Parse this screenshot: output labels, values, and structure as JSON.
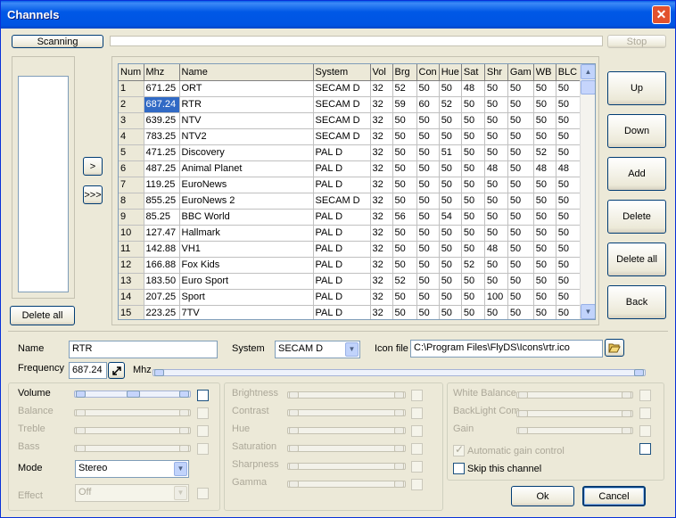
{
  "window": {
    "title": "Channels",
    "close_glyph": "✕"
  },
  "top": {
    "scanning_label": "Scanning",
    "stop_label": "Stop"
  },
  "left": {
    "add_one_label": ">",
    "add_all_label": ">>>",
    "delete_all_label": "Delete all"
  },
  "grid": {
    "columns": [
      "Num",
      "Mhz",
      "Name",
      "System",
      "Vol",
      "Brg",
      "Con",
      "Hue",
      "Sat",
      "Shr",
      "Gam",
      "WB",
      "BLC"
    ],
    "rows": [
      [
        "1",
        "671.25",
        "ORT",
        "SECAM D",
        "32",
        "52",
        "50",
        "50",
        "48",
        "50",
        "50",
        "50",
        "50"
      ],
      [
        "2",
        "687.24",
        "RTR",
        "SECAM D",
        "32",
        "59",
        "60",
        "52",
        "50",
        "50",
        "50",
        "50",
        "50"
      ],
      [
        "3",
        "639.25",
        "NTV",
        "SECAM D",
        "32",
        "50",
        "50",
        "50",
        "50",
        "50",
        "50",
        "50",
        "50"
      ],
      [
        "4",
        "783.25",
        "NTV2",
        "SECAM D",
        "32",
        "50",
        "50",
        "50",
        "50",
        "50",
        "50",
        "50",
        "50"
      ],
      [
        "5",
        "471.25",
        "Discovery",
        "PAL D",
        "32",
        "50",
        "50",
        "51",
        "50",
        "50",
        "50",
        "52",
        "50"
      ],
      [
        "6",
        "487.25",
        "Animal Planet",
        "PAL D",
        "32",
        "50",
        "50",
        "50",
        "50",
        "48",
        "50",
        "48",
        "48"
      ],
      [
        "7",
        "119.25",
        "EuroNews",
        "PAL D",
        "32",
        "50",
        "50",
        "50",
        "50",
        "50",
        "50",
        "50",
        "50"
      ],
      [
        "8",
        "855.25",
        "EuroNews 2",
        "SECAM D",
        "32",
        "50",
        "50",
        "50",
        "50",
        "50",
        "50",
        "50",
        "50"
      ],
      [
        "9",
        "85.25",
        "BBC World",
        "PAL D",
        "32",
        "56",
        "50",
        "54",
        "50",
        "50",
        "50",
        "50",
        "50"
      ],
      [
        "10",
        "127.47",
        "Hallmark",
        "PAL D",
        "32",
        "50",
        "50",
        "50",
        "50",
        "50",
        "50",
        "50",
        "50"
      ],
      [
        "11",
        "142.88",
        "VH1",
        "PAL D",
        "32",
        "50",
        "50",
        "50",
        "50",
        "48",
        "50",
        "50",
        "50"
      ],
      [
        "12",
        "166.88",
        "Fox Kids",
        "PAL D",
        "32",
        "50",
        "50",
        "50",
        "52",
        "50",
        "50",
        "50",
        "50"
      ],
      [
        "13",
        "183.50",
        "Euro Sport",
        "PAL D",
        "32",
        "52",
        "50",
        "50",
        "50",
        "50",
        "50",
        "50",
        "50"
      ],
      [
        "14",
        "207.25",
        "Sport",
        "PAL D",
        "32",
        "50",
        "50",
        "50",
        "50",
        "100",
        "50",
        "50",
        "50"
      ],
      [
        "15",
        "223.25",
        "7TV",
        "PAL D",
        "32",
        "50",
        "50",
        "50",
        "50",
        "50",
        "50",
        "50",
        "50"
      ]
    ]
  },
  "right_buttons": {
    "up": "Up",
    "down": "Down",
    "add": "Add",
    "delete": "Delete",
    "delete_all": "Delete all",
    "back": "Back"
  },
  "details": {
    "name_label": "Name",
    "name_value": "RTR",
    "system_label": "System",
    "system_value": "SECAM D",
    "icon_label": "Icon file",
    "icon_value": "C:\\Program Files\\FlyDS\\Icons\\rtr.ico",
    "frequency_label": "Frequency",
    "frequency_value": "687.24",
    "mhz_label": "Mhz"
  },
  "audio": {
    "volume": "Volume",
    "balance": "Balance",
    "treble": "Treble",
    "bass": "Bass",
    "mode_label": "Mode",
    "mode_value": "Stereo",
    "effect_label": "Effect",
    "effect_value": "Off"
  },
  "video": {
    "brightness": "Brightness",
    "contrast": "Contrast",
    "hue": "Hue",
    "saturation": "Saturation",
    "sharpness": "Sharpness",
    "gamma": "Gamma"
  },
  "extra": {
    "white_balance": "White Balance",
    "backlight": "BackLight Com",
    "gain": "Gain",
    "agc_label": "Automatic gain control",
    "skip_label": "Skip this channel"
  },
  "footer": {
    "ok_label": "Ok",
    "cancel_label": "Cancel"
  },
  "selection": {
    "row": 2,
    "column": "Mhz"
  }
}
